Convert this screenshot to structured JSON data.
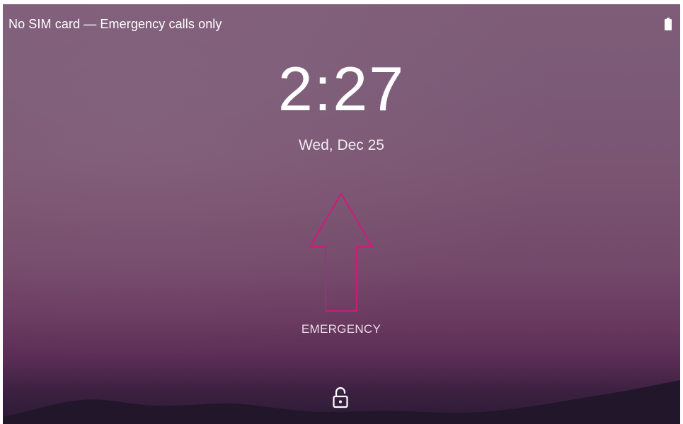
{
  "status_bar": {
    "carrier_text": "No SIM card — Emergency calls only",
    "battery_icon": "battery-icon"
  },
  "lockscreen": {
    "time": "2:27",
    "date": "Wed, Dec 25",
    "emergency_label": "EMERGENCY",
    "unlock_icon": "lock-open-icon",
    "arrow_icon": "up-arrow-icon"
  },
  "colors": {
    "text": "#ffffff",
    "arrow_outline": "#d4177e",
    "wallpaper_top": "#7f5d79",
    "wallpaper_bottom": "#2a1a33"
  }
}
